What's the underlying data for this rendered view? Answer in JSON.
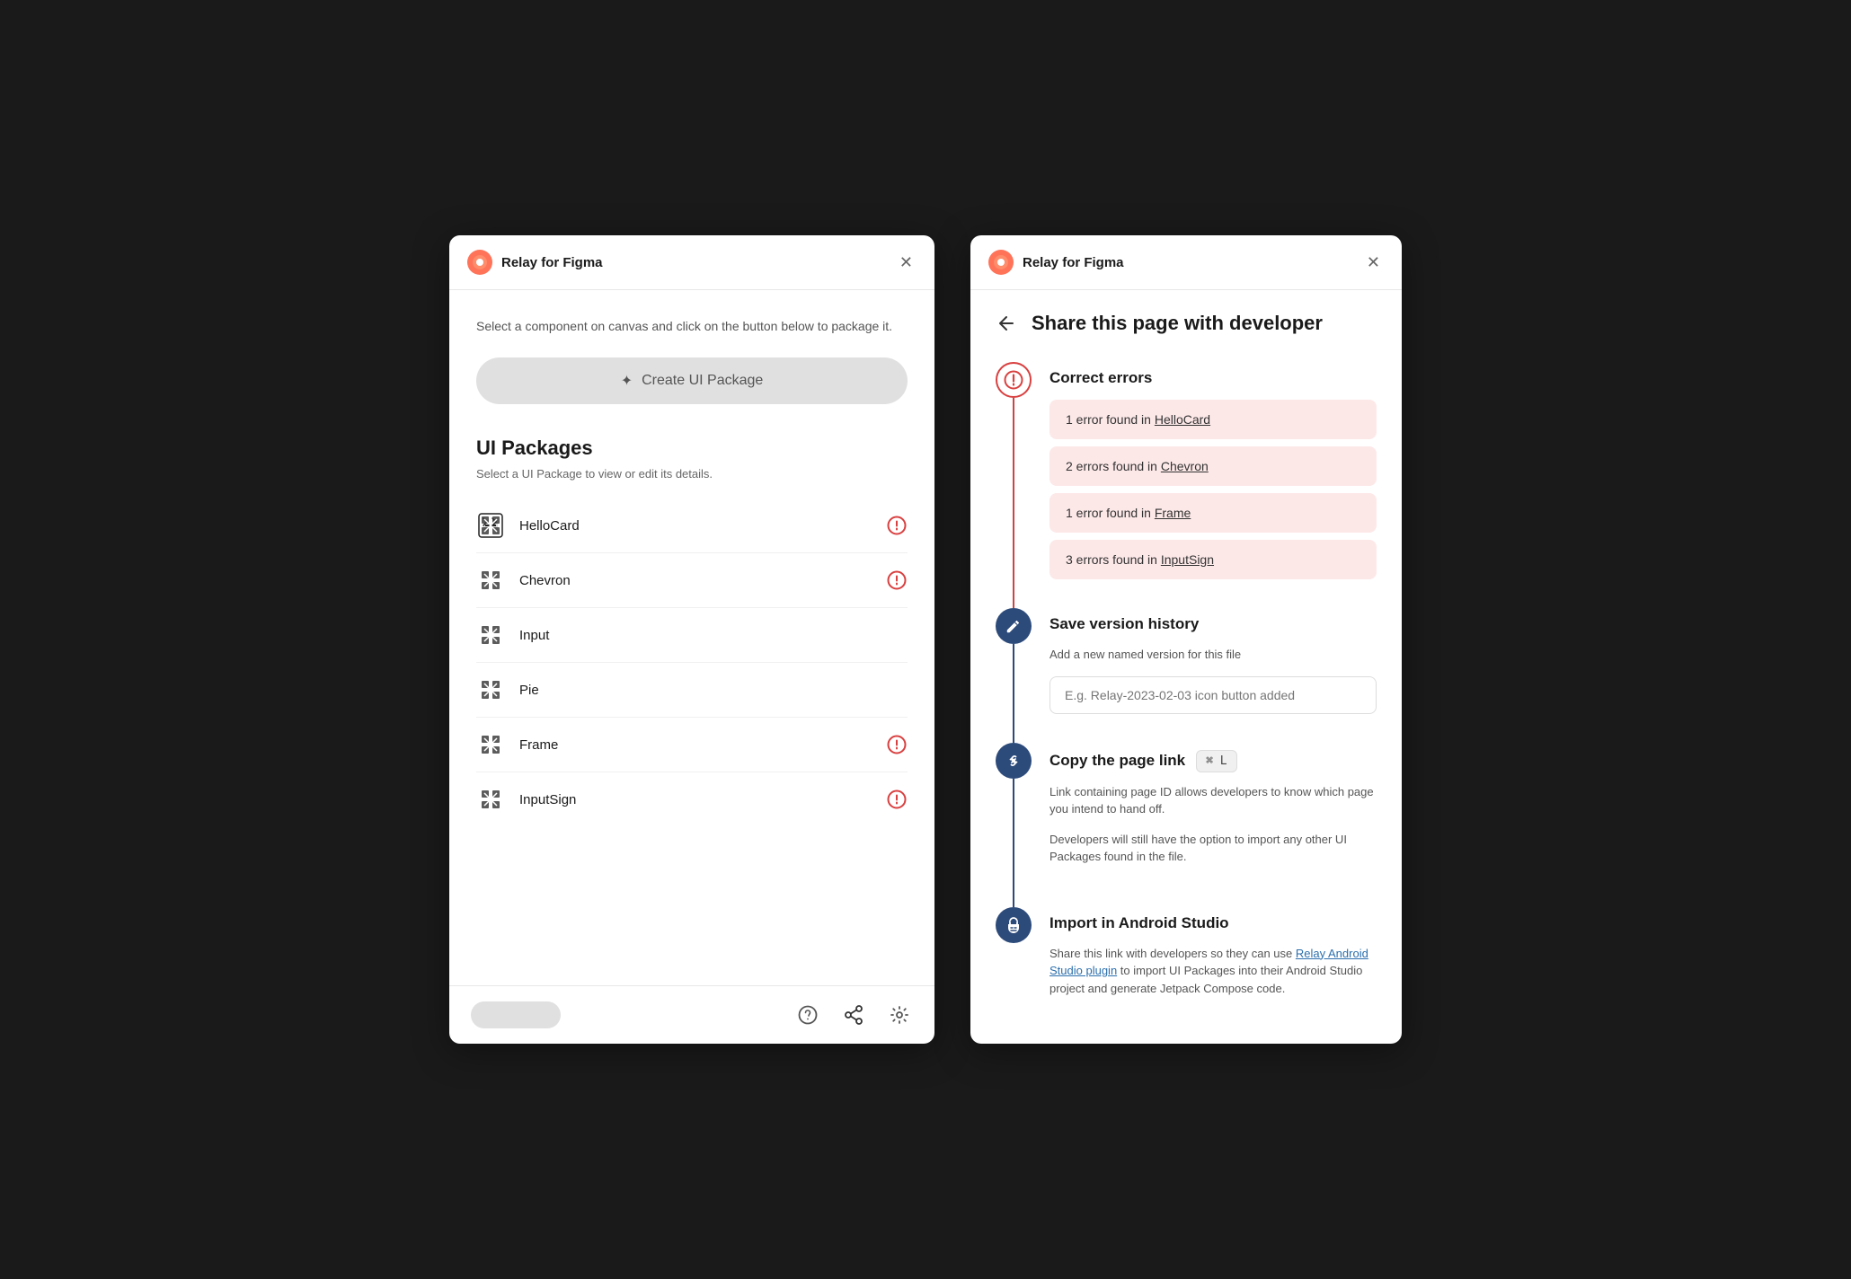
{
  "left_panel": {
    "title": "Relay for Figma",
    "description": "Select a component on canvas and click on the button below to package it.",
    "create_btn_label": "Create UI Package",
    "create_btn_icon": "✦",
    "section_title": "UI Packages",
    "section_subtitle": "Select a UI Package to view or edit its details.",
    "packages": [
      {
        "name": "HelloCard",
        "has_error": true
      },
      {
        "name": "Chevron",
        "has_error": true
      },
      {
        "name": "Input",
        "has_error": false
      },
      {
        "name": "Pie",
        "has_error": false
      },
      {
        "name": "Frame",
        "has_error": true
      },
      {
        "name": "InputSign",
        "has_error": true
      }
    ],
    "footer": {
      "help_label": "?",
      "share_label": "share",
      "settings_label": "settings"
    }
  },
  "right_panel": {
    "title": "Share this page with developer",
    "steps": [
      {
        "type": "error",
        "heading": "Correct errors",
        "errors": [
          "1 error found in HelloCard",
          "2 errors found in Chevron",
          "1 error found in Frame",
          "3 errors found in InputSign"
        ],
        "error_links": [
          "HelloCard",
          "Chevron",
          "Frame",
          "InputSign"
        ]
      },
      {
        "type": "pencil",
        "heading": "Save version history",
        "description": "Add a new named version for this file",
        "input_placeholder": "E.g. Relay-2023-02-03 icon button added"
      },
      {
        "type": "link",
        "heading": "Copy the page link",
        "kbd": "⌘ L",
        "description1": "Link containing page ID allows developers to know which page you intend to hand off.",
        "description2": "Developers will still have the option to import any other UI Packages found in the file."
      },
      {
        "type": "android",
        "heading": "Import in Android Studio",
        "description_prefix": "Share this link with developers so they can use ",
        "link_text": "Relay Android Studio plugin",
        "description_suffix": " to import UI Packages into their Android Studio project and generate Jetpack Compose code."
      }
    ]
  }
}
